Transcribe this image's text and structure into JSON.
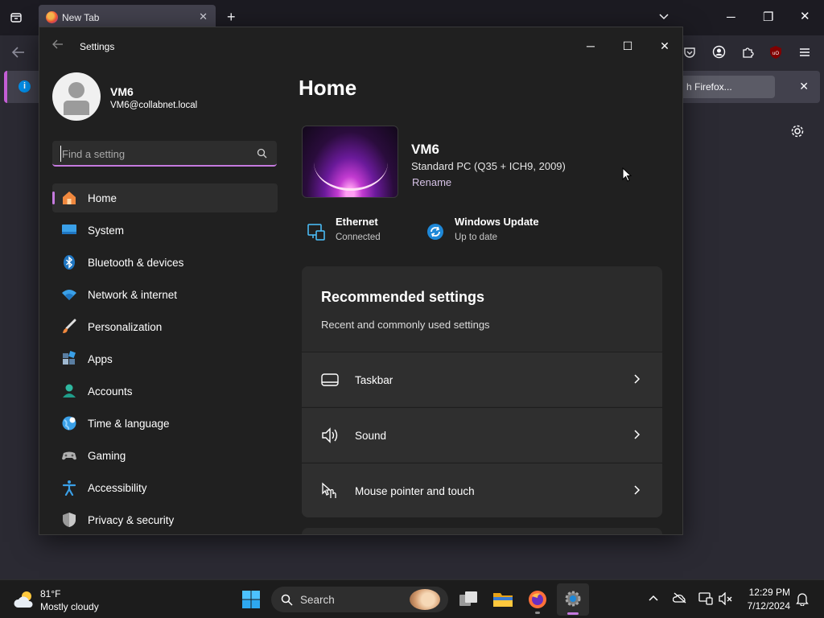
{
  "firefox": {
    "tab_title": "New Tab",
    "notification_button": "h Firefox...",
    "notification_info": "i"
  },
  "settings": {
    "window_title": "Settings",
    "account": {
      "name": "VM6",
      "email": "VM6@collabnet.local"
    },
    "search": {
      "placeholder": "Find a setting",
      "value": ""
    },
    "nav": [
      {
        "label": "Home",
        "icon": "home-icon",
        "active": true
      },
      {
        "label": "System",
        "icon": "system-icon"
      },
      {
        "label": "Bluetooth & devices",
        "icon": "bluetooth-icon"
      },
      {
        "label": "Network & internet",
        "icon": "wifi-icon"
      },
      {
        "label": "Personalization",
        "icon": "brush-icon"
      },
      {
        "label": "Apps",
        "icon": "apps-icon"
      },
      {
        "label": "Accounts",
        "icon": "accounts-icon"
      },
      {
        "label": "Time & language",
        "icon": "globe-icon"
      },
      {
        "label": "Gaming",
        "icon": "gamepad-icon"
      },
      {
        "label": "Accessibility",
        "icon": "accessibility-icon"
      },
      {
        "label": "Privacy & security",
        "icon": "shield-icon"
      }
    ],
    "main": {
      "title": "Home",
      "device": {
        "name": "VM6",
        "model": "Standard PC (Q35 + ICH9, 2009)",
        "rename": "Rename"
      },
      "status": [
        {
          "title": "Ethernet",
          "subtitle": "Connected",
          "icon": "ethernet-icon"
        },
        {
          "title": "Windows Update",
          "subtitle": "Up to date",
          "icon": "windows-update-icon"
        }
      ],
      "recommended": {
        "title": "Recommended settings",
        "subtitle": "Recent and commonly used settings",
        "items": [
          {
            "label": "Taskbar",
            "icon": "taskbar-icon"
          },
          {
            "label": "Sound",
            "icon": "speaker-icon"
          },
          {
            "label": "Mouse pointer and touch",
            "icon": "pointer-touch-icon"
          }
        ]
      }
    }
  },
  "taskbar": {
    "weather": {
      "temp": "81°F",
      "condition": "Mostly cloudy"
    },
    "search_label": "Search",
    "clock": {
      "time": "12:29 PM",
      "date": "7/12/2024"
    }
  },
  "colors": {
    "accent": "#c57adf",
    "window_bg": "#202020",
    "card_bg": "#2b2b2b",
    "firefox_bg": "#2b2a33"
  }
}
